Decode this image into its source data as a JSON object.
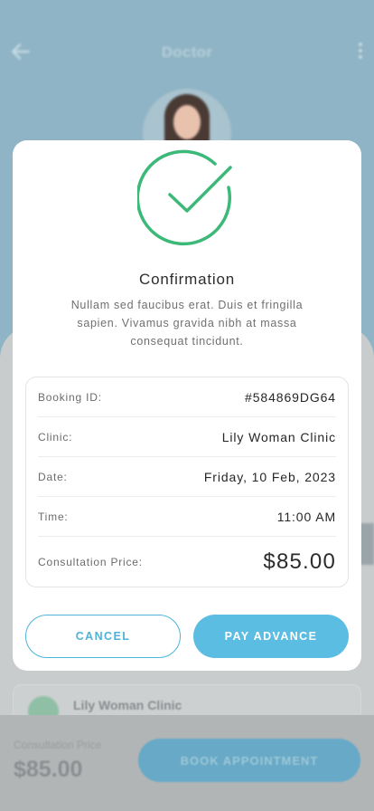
{
  "background": {
    "header": {
      "title": "Doctor",
      "back_icon": "arrow-left-icon",
      "more_icon": "more-vertical-icon"
    },
    "clinic_card": {
      "name": "Lily Woman Clinic"
    },
    "bottom_bar": {
      "price_label": "Consultation Price",
      "price": "$85.00",
      "book_label": "BOOK APPOINTMENT"
    }
  },
  "modal": {
    "icon": "check-circle-icon",
    "title": "Confirmation",
    "description": "Nullam sed faucibus erat. Duis et fringilla sapien. Vivamus gravida nibh at massa consequat tincidunt.",
    "details": [
      {
        "label": "Booking ID:",
        "value": "#584869DG64"
      },
      {
        "label": "Clinic:",
        "value": "Lily Woman Clinic"
      },
      {
        "label": "Date:",
        "value": "Friday, 10 Feb, 2023"
      },
      {
        "label": "Time:",
        "value": "11:00 AM"
      },
      {
        "label": "Consultation Price:",
        "value": "$85.00"
      }
    ],
    "cancel_label": "CANCEL",
    "pay_label": "PAY ADVANCE"
  },
  "colors": {
    "accent": "#5bbde1",
    "success": "#3cb878",
    "overlay": "#8fb4c5"
  }
}
